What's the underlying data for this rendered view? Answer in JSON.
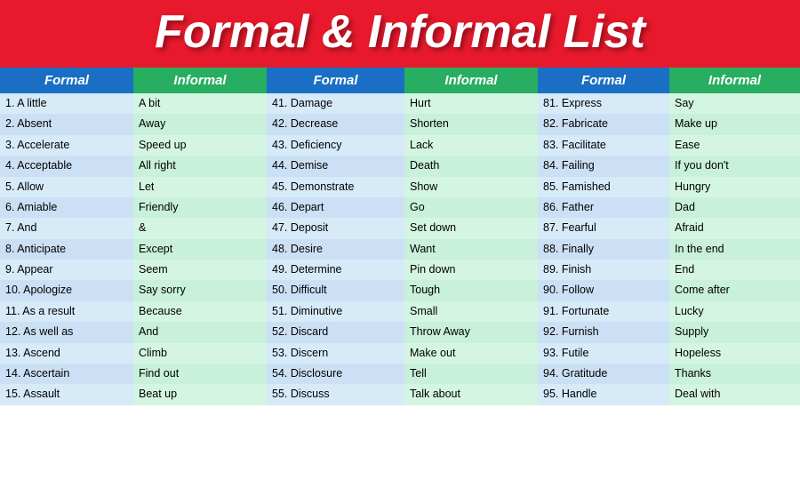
{
  "header": {
    "title": "Formal & Informal List"
  },
  "columns": [
    {
      "label": "Formal",
      "type": "formal"
    },
    {
      "label": "Informal",
      "type": "informal"
    },
    {
      "label": "Formal",
      "type": "formal"
    },
    {
      "label": "Informal",
      "type": "informal"
    },
    {
      "label": "Formal",
      "type": "formal"
    },
    {
      "label": "Informal",
      "type": "informal"
    }
  ],
  "rows": [
    {
      "f1": "1. A little",
      "i1": "A bit",
      "f2": "41. Damage",
      "i2": "Hurt",
      "f3": "81. Express",
      "i3": "Say"
    },
    {
      "f1": "2. Absent",
      "i1": "Away",
      "f2": "42. Decrease",
      "i2": "Shorten",
      "f3": "82. Fabricate",
      "i3": "Make up"
    },
    {
      "f1": "3. Accelerate",
      "i1": "Speed up",
      "f2": "43. Deficiency",
      "i2": "Lack",
      "f3": "83. Facilitate",
      "i3": "Ease"
    },
    {
      "f1": "4. Acceptable",
      "i1": "All right",
      "f2": "44. Demise",
      "i2": "Death",
      "f3": "84. Failing",
      "i3": "If you don't"
    },
    {
      "f1": "5. Allow",
      "i1": "Let",
      "f2": "45. Demonstrate",
      "i2": "Show",
      "f3": "85. Famished",
      "i3": "Hungry"
    },
    {
      "f1": "6. Amiable",
      "i1": "Friendly",
      "f2": "46. Depart",
      "i2": "Go",
      "f3": "86. Father",
      "i3": "Dad"
    },
    {
      "f1": "7. And",
      "i1": "&",
      "f2": "47. Deposit",
      "i2": "Set down",
      "f3": "87. Fearful",
      "i3": "Afraid"
    },
    {
      "f1": "8. Anticipate",
      "i1": "Except",
      "f2": "48. Desire",
      "i2": "Want",
      "f3": "88. Finally",
      "i3": "In the end"
    },
    {
      "f1": "9. Appear",
      "i1": "Seem",
      "f2": "49. Determine",
      "i2": "Pin down",
      "f3": "89. Finish",
      "i3": "End"
    },
    {
      "f1": "10. Apologize",
      "i1": "Say sorry",
      "f2": "50. Difficult",
      "i2": "Tough",
      "f3": "90. Follow",
      "i3": "Come after"
    },
    {
      "f1": "11. As a result",
      "i1": "Because",
      "f2": "51. Diminutive",
      "i2": "Small",
      "f3": "91. Fortunate",
      "i3": "Lucky"
    },
    {
      "f1": "12. As well as",
      "i1": "And",
      "f2": "52. Discard",
      "i2": "Throw Away",
      "f3": "92. Furnish",
      "i3": "Supply"
    },
    {
      "f1": "13. Ascend",
      "i1": "Climb",
      "f2": "53. Discern",
      "i2": "Make out",
      "f3": "93. Futile",
      "i3": "Hopeless"
    },
    {
      "f1": "14. Ascertain",
      "i1": "Find out",
      "f2": "54. Disclosure",
      "i2": "Tell",
      "f3": "94. Gratitude",
      "i3": "Thanks"
    },
    {
      "f1": "15. Assault",
      "i1": "Beat up",
      "f2": "55. Discuss",
      "i2": "Talk about",
      "f3": "95. Handle",
      "i3": "Deal with"
    }
  ]
}
